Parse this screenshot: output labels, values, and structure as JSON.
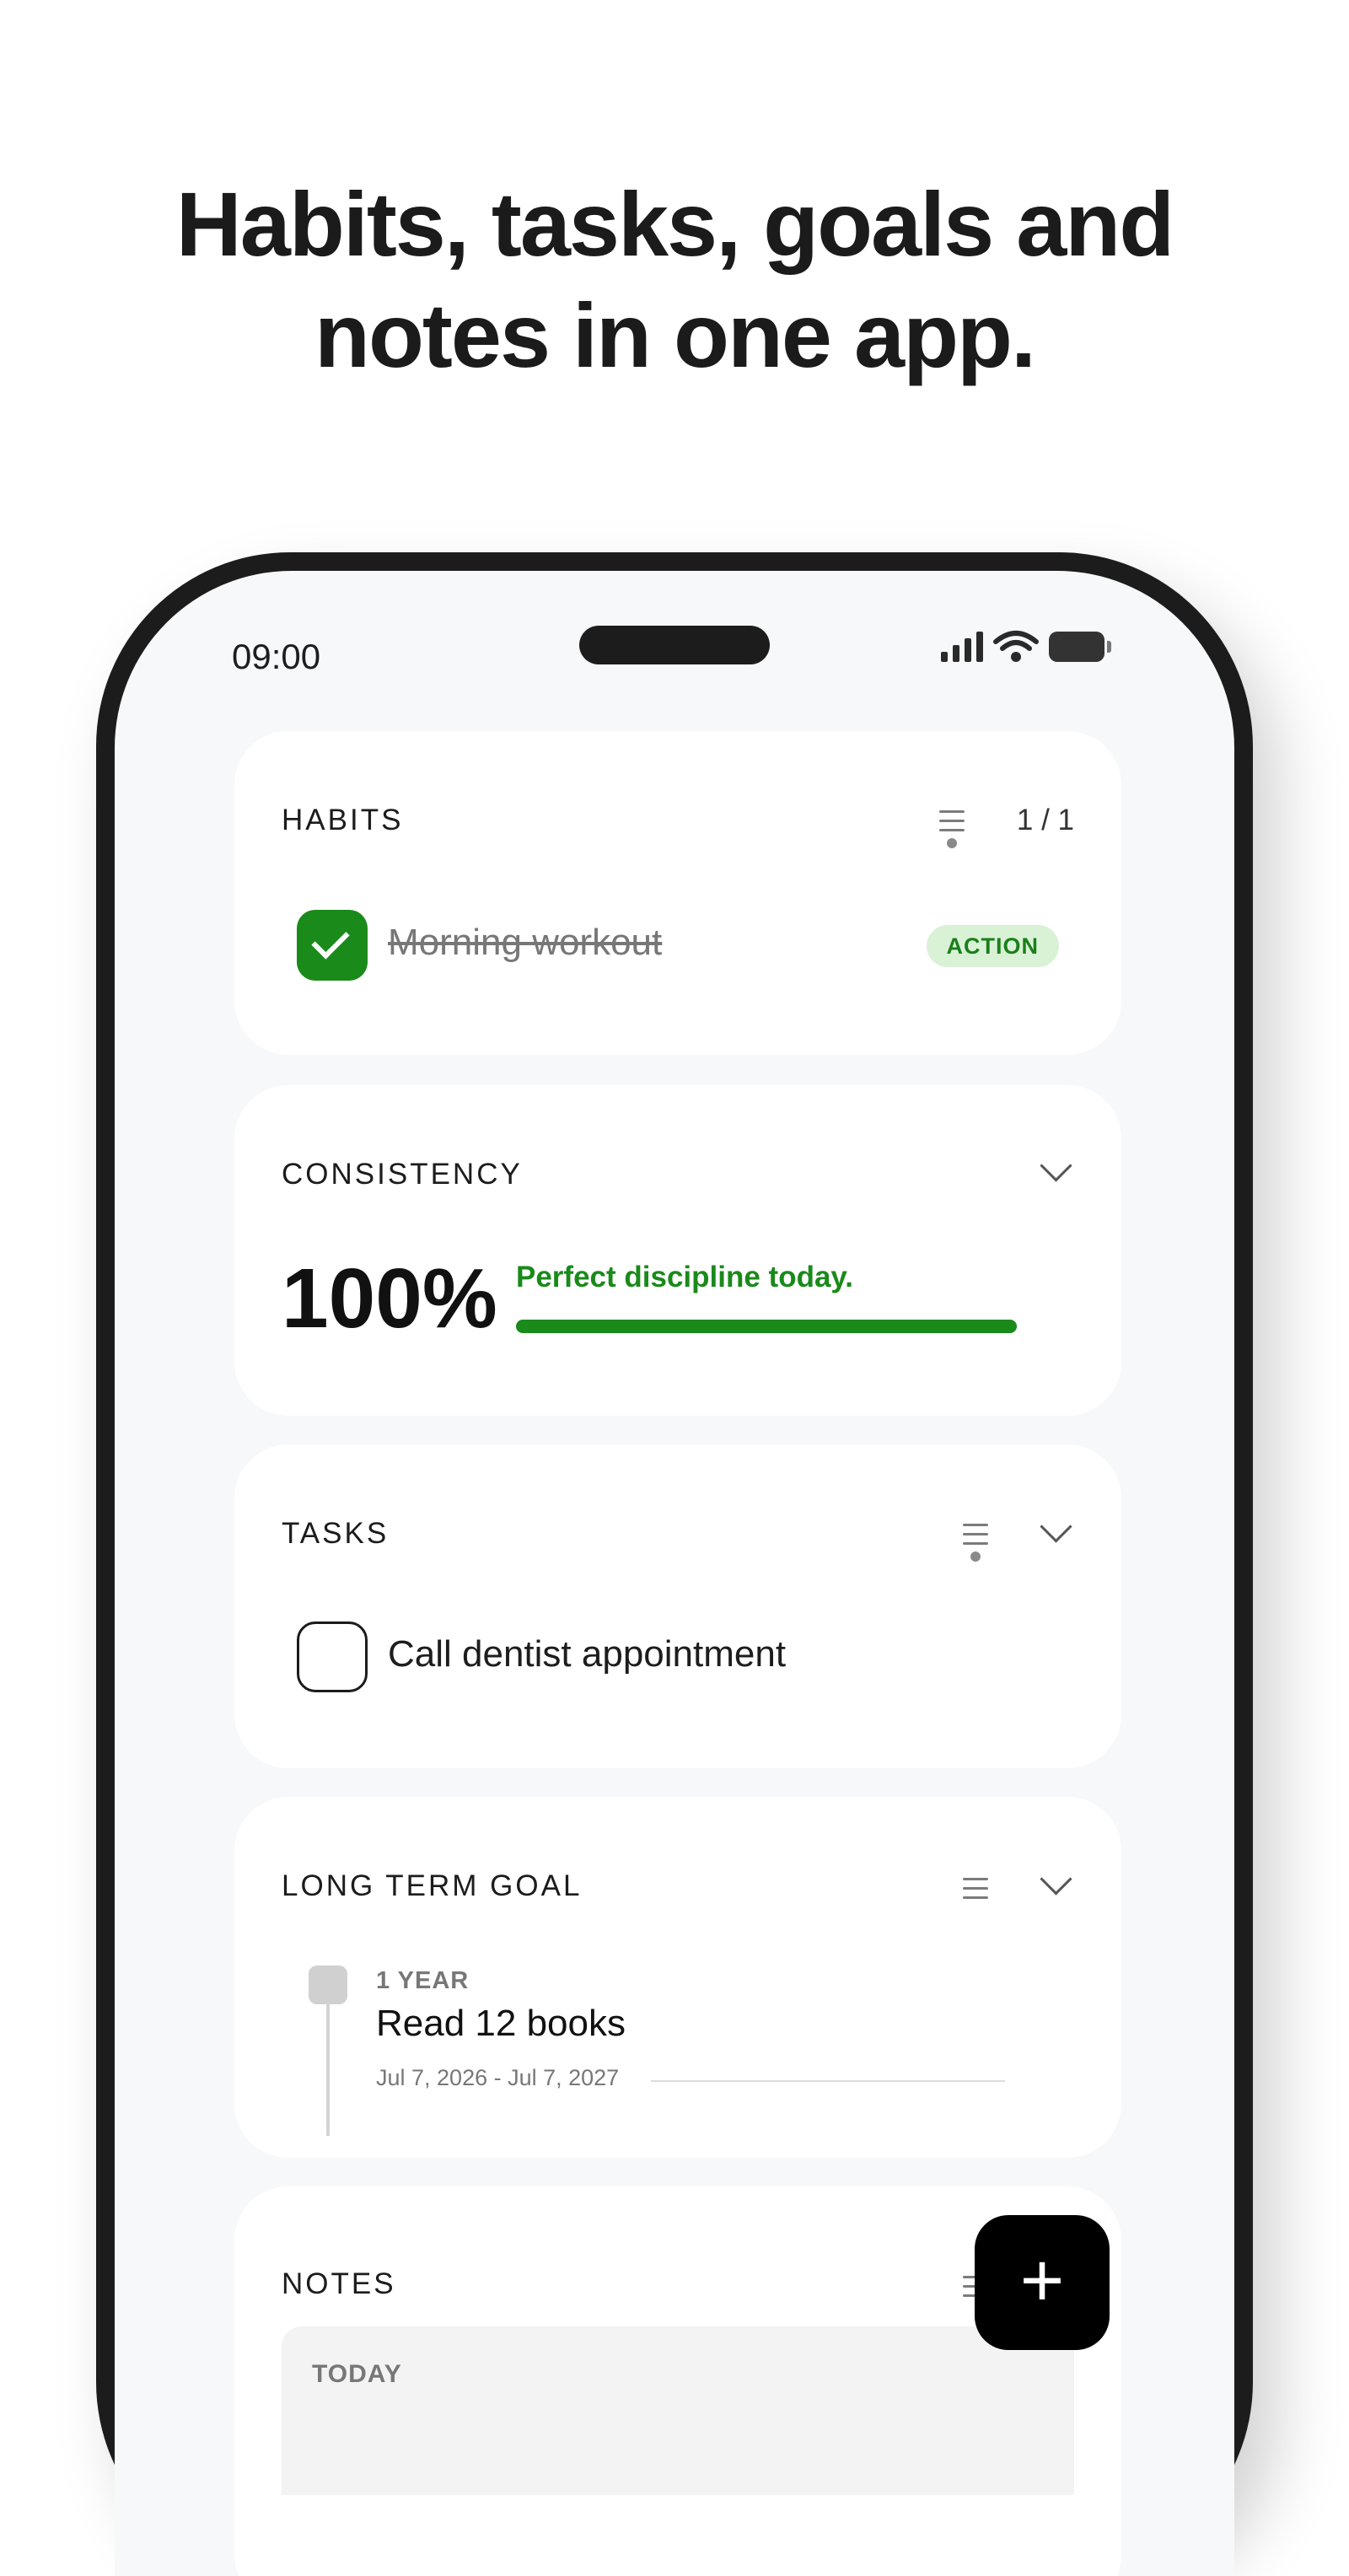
{
  "headline": [
    "Habits, tasks, goals and",
    "notes in one app."
  ],
  "status_bar": {
    "time": "09:00"
  },
  "habits": {
    "title": "HABITS",
    "count": "1 / 1",
    "item": {
      "label": "Morning workout",
      "done": true,
      "badge": "ACTION"
    }
  },
  "consistency": {
    "title": "CONSISTENCY",
    "percent_text": "100%",
    "progress": 1.0,
    "message": "Perfect discipline today."
  },
  "tasks": {
    "title": "TASKS",
    "item": {
      "label": "Call dentist appointment",
      "done": false
    }
  },
  "long_term_goal": {
    "title": "LONG TERM GOAL",
    "period": "1 YEAR",
    "goal": "Read 12 books",
    "dates": "Jul 7, 2026 - Jul 7, 2027"
  },
  "notes": {
    "title": "NOTES",
    "group_label": "TODAY"
  },
  "fab": {
    "label": "+"
  },
  "colors": {
    "accent_green": "#1a8a1a",
    "badge_bg": "#d9f2d6"
  }
}
